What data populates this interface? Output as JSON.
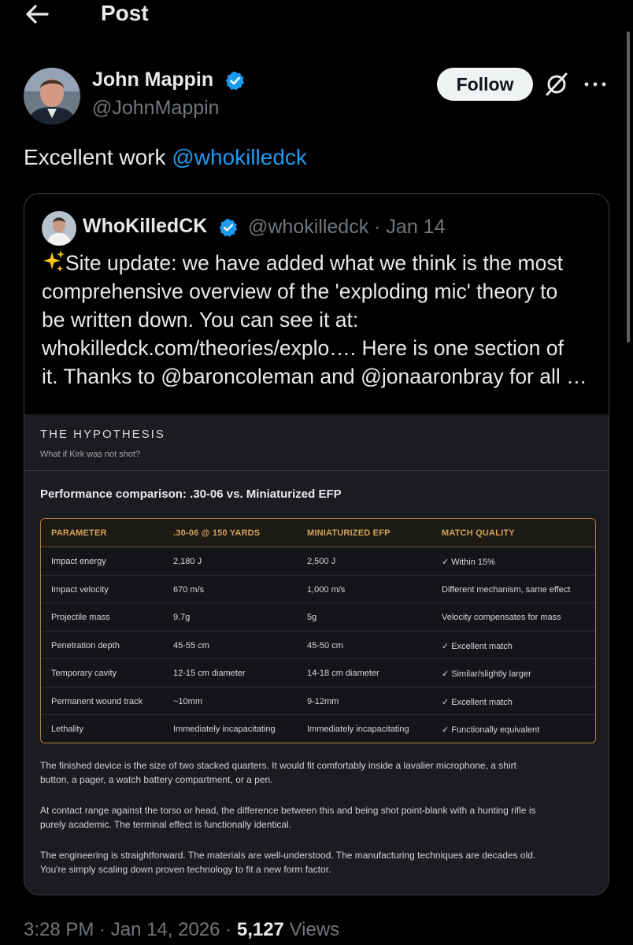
{
  "header": {
    "title": "Post"
  },
  "post": {
    "author_name": "John Mappin",
    "author_handle": "@JohnMappin",
    "follow_label": "Follow",
    "text_prefix": "Excellent work ",
    "text_mention": "@whokilledck",
    "time": "3:28 PM",
    "date": "Jan 14, 2026",
    "views_count": "5,127",
    "views_label": "Views"
  },
  "quote": {
    "author_name": "WhoKilledCK",
    "author_handle": "@whokilledck · Jan 14",
    "lines": [
      "Site update: we have added what we think is the most",
      "comprehensive overview of the 'exploding mic' theory to",
      "be written down. You can see it at:",
      "whokilledck.com/theories/explo…. Here is one section of",
      "it. Thanks to @baroncoleman and @jonaaronbray for all …"
    ]
  },
  "image": {
    "section_title": "THE HYPOTHESIS",
    "section_subtitle": "What if Kirk was not shot?",
    "table_title": "Performance comparison: .30-06 vs. Miniaturized EFP",
    "columns": [
      "PARAMETER",
      ".30-06 @ 150 YARDS",
      "MINIATURIZED EFP",
      "MATCH QUALITY"
    ],
    "rows": [
      [
        "Impact energy",
        "2,180 J",
        "2,500 J",
        "✓ Within 15%"
      ],
      [
        "Impact velocity",
        "670 m/s",
        "1,000 m/s",
        "Different mechanism, same effect"
      ],
      [
        "Projectile mass",
        "9.7g",
        "5g",
        "Velocity compensates for mass"
      ],
      [
        "Penetration depth",
        "45-55 cm",
        "45-50 cm",
        "✓ Excellent match"
      ],
      [
        "Temporary cavity",
        "12-15 cm diameter",
        "14-18 cm diameter",
        "✓ Similar/slightly larger"
      ],
      [
        "Permanent wound track",
        "~10mm",
        "9-12mm",
        "✓ Excellent match"
      ],
      [
        "Lethality",
        "Immediately incapacitating",
        "Immediately incapacitating",
        "✓ Functionally equivalent"
      ]
    ],
    "paragraphs": [
      [
        "The finished device is the size of two stacked quarters. It would fit comfortably inside a lavalier microphone, a shirt",
        "button, a pager, a watch battery compartment, or a pen."
      ],
      [
        "At contact range against the torso or head, the difference between this and being shot point-blank with a hunting rifle is",
        "purely academic. The terminal effect is functionally identical."
      ],
      [
        "The engineering is straightforward. The materials are well-understood. The manufacturing techniques are decades old.",
        "You're simply scaling down proven technology to fit a new form factor."
      ]
    ]
  }
}
